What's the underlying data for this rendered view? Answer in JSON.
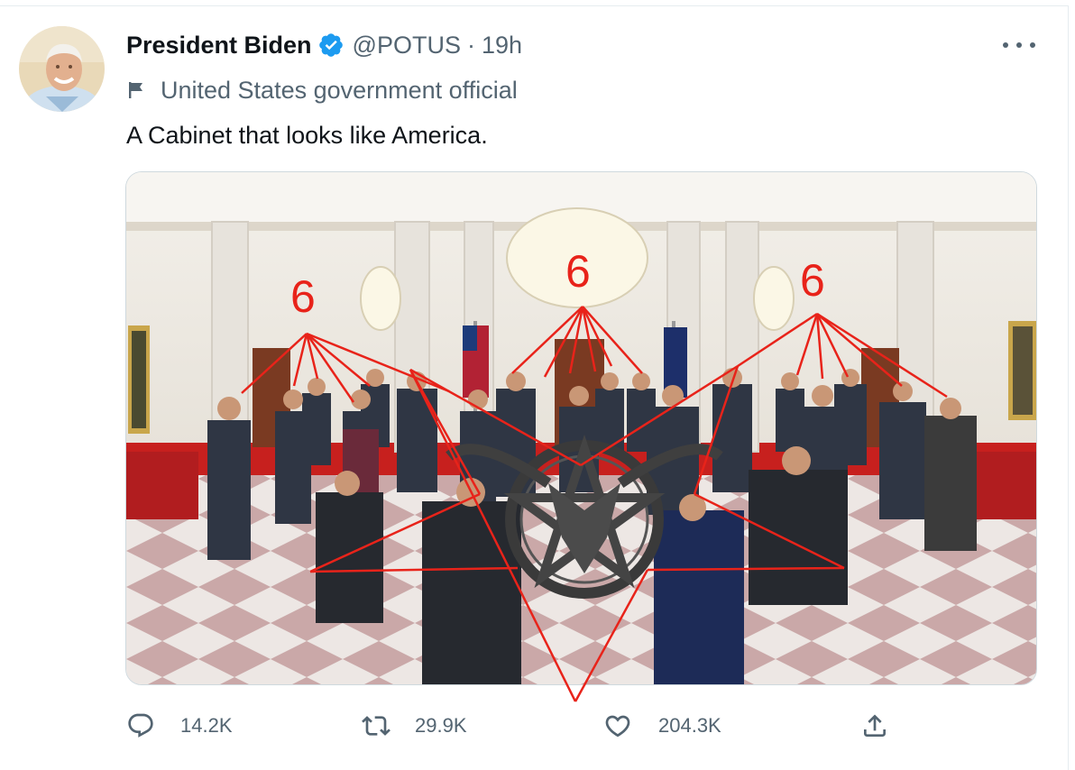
{
  "tweet": {
    "author_name": "President Biden",
    "handle": "@POTUS",
    "separator": "·",
    "time": "19h",
    "account_label": "United States government official",
    "text": "A Cabinet that looks like America.",
    "overlay_numbers": [
      "6",
      "6",
      "6"
    ]
  },
  "actions": {
    "replies": "14.2K",
    "retweets": "29.9K",
    "likes": "204.3K"
  },
  "icons": [
    "avatar",
    "verified-badge-icon",
    "more-icon",
    "flag-icon",
    "reply-icon",
    "retweet-icon",
    "like-icon",
    "share-icon"
  ],
  "colors": {
    "text_primary": "#0f1419",
    "text_secondary": "#536471",
    "verified_blue": "#1d9bf0",
    "overlay_red": "#e8231a"
  }
}
